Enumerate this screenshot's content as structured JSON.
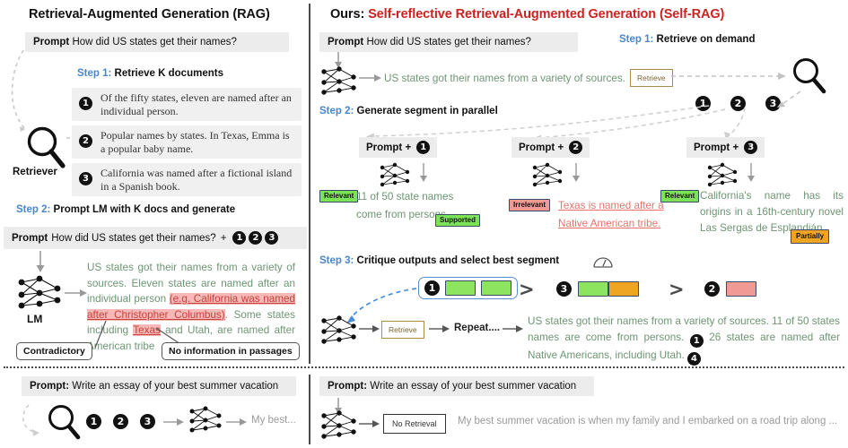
{
  "left": {
    "title": "Retrieval-Augmented Generation (RAG)",
    "prompt_label": "Prompt",
    "prompt_text": "How did US states get their names?",
    "step1_num": "Step 1:",
    "step1_text": "Retrieve K documents",
    "retriever_label": "Retriever",
    "documents": [
      {
        "num": "1",
        "text": "Of the fifty states, eleven are named after an individual person."
      },
      {
        "num": "2",
        "text": "Popular names by states. In Texas, Emma is a popular baby name."
      },
      {
        "num": "3",
        "text": "California was named after a fictional island in a Spanish book."
      }
    ],
    "step2_num": "Step 2:",
    "step2_text": "Prompt LM with K docs and generate",
    "prompt2_label": "Prompt",
    "prompt2_text": "How did US states get their names?",
    "plus": "+",
    "prompt2_docs": [
      "1",
      "2",
      "3"
    ],
    "lm_label": "LM",
    "output": {
      "seg1": "US states got their names from a variety of sources. Eleven states are named after an individual person ",
      "seg_red1": "(e.g. California was named after Christopher Columbus)",
      "seg2": ". Some states including ",
      "seg_red2": "Texas",
      "seg3": " and Utah, are named after ",
      "seg4": "American tribe"
    },
    "callout_contradictory": "Contradictory",
    "callout_noinfo": "No information in passages"
  },
  "right": {
    "title_prefix": "Ours:",
    "title_main": "Self-reflective Retrieval-Augmented Generation (",
    "title_tag": "Self-RAG",
    "title_suffix": ")",
    "prompt_label": "Prompt",
    "prompt_text": "How did US states get their names?",
    "step1_num": "Step 1:",
    "step1_text": "Retrieve on demand",
    "gen_line1": "US states got their names from a variety of sources.",
    "retrieve_token": "Retrieve",
    "doc_circles": [
      "1",
      "2",
      "3"
    ],
    "step2_num": "Step 2:",
    "step2_text": "Generate segment in parallel",
    "branches": [
      {
        "prompt_label": "Prompt +",
        "num": "1",
        "badge1": "Relevant",
        "badge1_style": "green",
        "text": "11 of 50 state names come from persons.",
        "badge2": "Supported",
        "badge2_style": "green",
        "text_style": "green"
      },
      {
        "prompt_label": "Prompt +",
        "num": "2",
        "badge1": "Irrelevant",
        "badge1_style": "red",
        "text": "Texas is named after a Native American tribe.",
        "badge2": "",
        "badge2_style": "",
        "text_style": "red"
      },
      {
        "prompt_label": "Prompt +",
        "num": "3",
        "badge1": "Relevant",
        "badge1_style": "green",
        "text": "California's name has its origins in a 16th-century novel Las Sergas de Esplandián.",
        "badge2": "Partially",
        "badge2_style": "orange",
        "text_style": "green"
      }
    ],
    "step3_num": "Step 3:",
    "step3_text": "Critique outputs and select best segment",
    "ranking": [
      {
        "num": "1",
        "chips": [
          "green",
          "green"
        ],
        "selected": true
      },
      {
        "num": "3",
        "chips": [
          "green",
          "orange"
        ],
        "selected": false
      },
      {
        "num": "2",
        "chips": [
          "red"
        ],
        "selected": false
      }
    ],
    "rank_sep": ">",
    "retrieve_token2": "Retrieve",
    "repeat_label": "Repeat....",
    "final_output": {
      "part1": "US states got their names from a variety of sources. 11 of 50 states names are come from persons.",
      "marker1": "1",
      "part2": "26 states are named after Native Americans, including Utah.",
      "marker2": "4"
    }
  },
  "bottom_left": {
    "prompt_label": "Prompt:",
    "prompt_text": "Write an essay of your best summer vacation",
    "circles": [
      "1",
      "2",
      "3"
    ],
    "output_text": "My best..."
  },
  "bottom_right": {
    "prompt_label": "Prompt:",
    "prompt_text": "Write an essay of your best summer vacation",
    "no_retrieval_token": "No Retrieval",
    "output_text": "My best summer vacation is when my family and I embarked on a road trip along ..."
  },
  "colors": {
    "step_blue": "#4a86c8",
    "title_red": "#cc2222",
    "generated_green": "#6d9673",
    "error_red": "#e8716d",
    "badge_green": "#7de356",
    "badge_orange": "#efa522",
    "badge_red": "#ef9a94",
    "retrieve_border": "#a98b4e"
  }
}
